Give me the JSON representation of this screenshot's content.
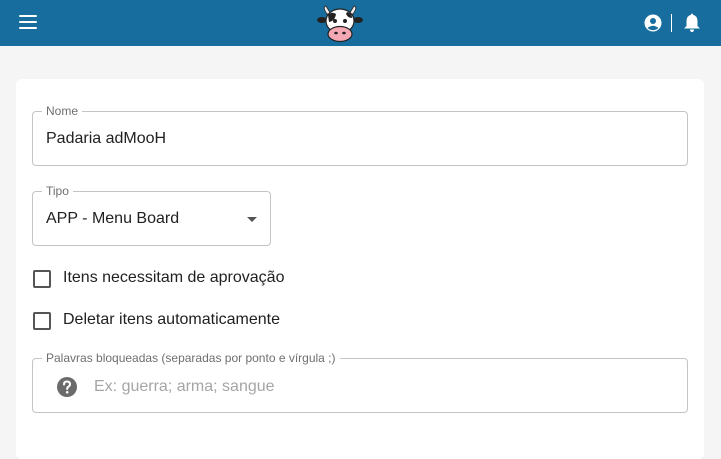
{
  "colors": {
    "appbar": "#166d9e",
    "icon_grey": "#6b6b6b"
  },
  "header": {
    "menu_icon": "menu-icon",
    "logo": "cow-logo",
    "account_icon": "account-circle-icon",
    "notifications_icon": "bell-icon"
  },
  "form": {
    "name": {
      "label": "Nome",
      "value": "Padaria adMooH"
    },
    "type": {
      "label": "Tipo",
      "value": "APP - Menu Board"
    },
    "checkboxes": [
      {
        "label": "Itens necessitam de aprovação",
        "checked": false
      },
      {
        "label": "Deletar itens automaticamente",
        "checked": false
      }
    ],
    "blocked_words": {
      "label": "Palavras bloqueadas (separadas por ponto e vírgula ;)",
      "placeholder": "Ex: guerra; arma; sangue",
      "icon": "help-circle-icon"
    }
  }
}
